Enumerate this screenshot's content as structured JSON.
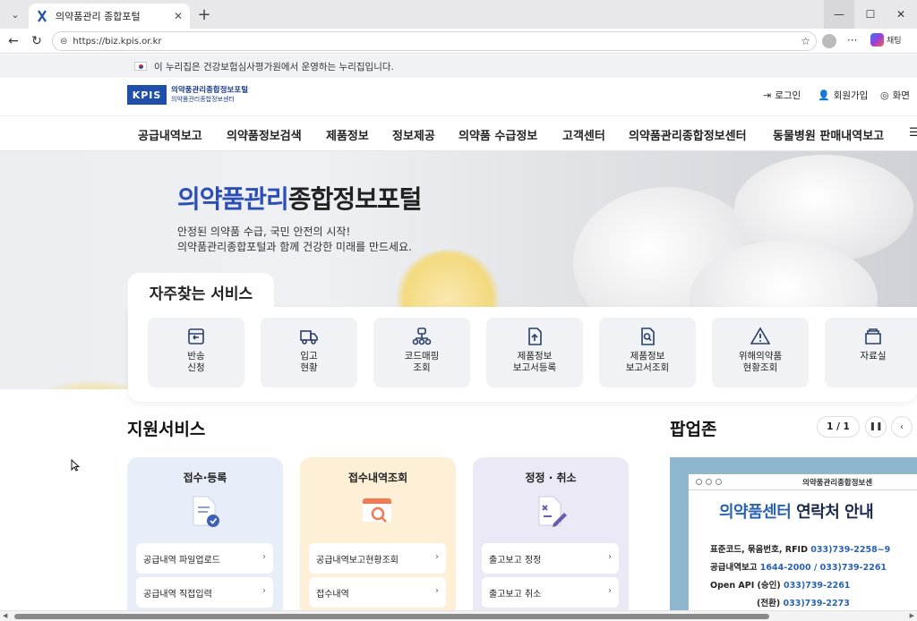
{
  "browser": {
    "tab_title": "의약품관리 종합포털",
    "url": "https://biz.kpis.or.kr",
    "copilot_label": "채팅"
  },
  "notice": "이 누리집은 건강보험심사평가원에서 운영하는 누리집입니다.",
  "header": {
    "logo_mark": "KPIS",
    "logo_line1": "의약품관리종합정보포털",
    "logo_line2": "의약품관리종합정보센터",
    "login": "로그인",
    "signup": "회원가입",
    "sitemap": "화면"
  },
  "gnb": [
    "공급내역보고",
    "의약품정보검색",
    "제품정보",
    "정보제공",
    "의약품 수급정보",
    "고객센터",
    "의약품관리종합정보센터",
    "동물병원 판매내역보고"
  ],
  "hero": {
    "title_highlight": "의약품관리",
    "title_rest": "종합정보포털",
    "sub1": "안정된 의약품 수급, 국민 안전의 시작!",
    "sub2": "의약품관리종합포털과 함께 건강한 미래를 만드세요."
  },
  "quick": {
    "title": "자주찾는 서비스",
    "items": [
      {
        "label": "반송\n신청",
        "icon": "return-box-icon"
      },
      {
        "label": "입고\n현황",
        "icon": "truck-icon"
      },
      {
        "label": "코드매핑\n조회",
        "icon": "code-mapping-icon"
      },
      {
        "label": "제품정보\n보고서등록",
        "icon": "upload-document-icon"
      },
      {
        "label": "제품정보\n보고서조회",
        "icon": "search-document-icon"
      },
      {
        "label": "위해의약품\n현황조회",
        "icon": "warning-icon"
      },
      {
        "label": "자료실",
        "icon": "archive-icon"
      }
    ]
  },
  "support": {
    "title": "지원서비스",
    "cards": [
      {
        "title": "접수·등록",
        "rows": [
          "공급내역 파일업로드",
          "공급내역 직접입력"
        ],
        "color": "#e7edf9"
      },
      {
        "title": "접수내역조회",
        "rows": [
          "공급내역보고현황조회",
          "접수내역"
        ],
        "color": "#fdf0d7"
      },
      {
        "title": "정정 · 취소",
        "rows": [
          "출고보고 정정",
          "출고보고 취소"
        ],
        "color": "#ece9f6"
      }
    ]
  },
  "popup": {
    "title": "팝업존",
    "pager": "1 / 1",
    "poster": {
      "window_title": "의약품관리종합정보센",
      "title_highlight": "의약품센터",
      "title_rest": " 연락처 안내",
      "lines": [
        {
          "label": "표준코드, 묶음번호, RFID ",
          "value": "033)739-2258~9"
        },
        {
          "label": "공급내역보고 ",
          "value": "1644-2000 /  033)739-2261"
        },
        {
          "label": "Open API (승인) ",
          "value": "033)739-2261"
        },
        {
          "label": "(전환) ",
          "value": "033)739-2273"
        }
      ]
    }
  },
  "colors": {
    "brand": "#1f4fa8",
    "hero_highlight": "#2c4fb5"
  }
}
